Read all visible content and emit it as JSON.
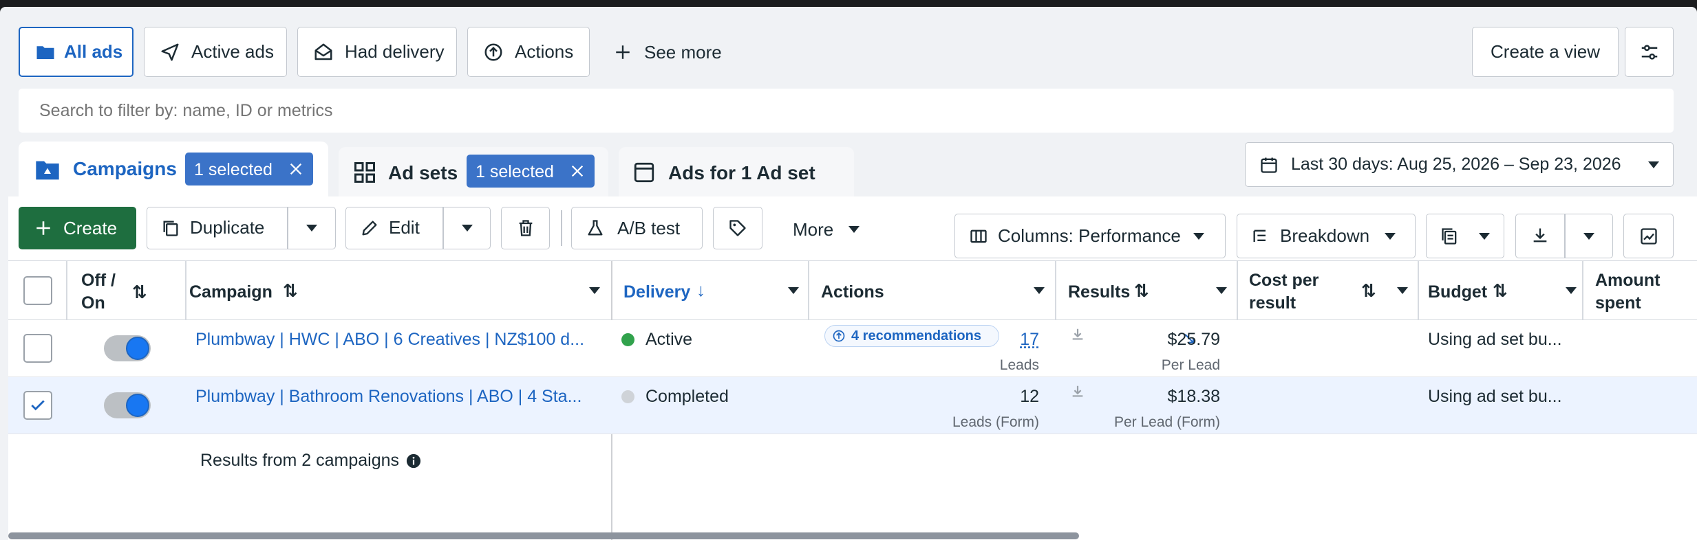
{
  "filters": {
    "all_ads": "All ads",
    "active_ads": "Active ads",
    "had_delivery": "Had delivery",
    "actions": "Actions",
    "see_more": "See more",
    "create_view": "Create a view"
  },
  "search": {
    "placeholder": "Search to filter by: name, ID or metrics"
  },
  "tabs": {
    "campaigns": {
      "label": "Campaigns",
      "badge": "1 selected"
    },
    "ad_sets": {
      "label": "Ad sets",
      "badge": "1 selected"
    },
    "ads": {
      "label": "Ads for 1 Ad set"
    }
  },
  "date_range": "Last 30 days: Aug 25, 2026 – Sep 23, 2026",
  "toolbar": {
    "create": "Create",
    "duplicate": "Duplicate",
    "edit": "Edit",
    "ab_test": "A/B test",
    "more": "More",
    "columns": "Columns: Performance",
    "breakdown": "Breakdown"
  },
  "table": {
    "headers": {
      "off_on_1": "Off /",
      "off_on_2": "On",
      "campaign": "Campaign",
      "delivery": "Delivery",
      "actions": "Actions",
      "results": "Results",
      "cost_1": "Cost per",
      "cost_2": "result",
      "budget": "Budget",
      "amount_1": "Amount",
      "amount_2": "spent"
    },
    "rows": [
      {
        "campaign": "Plumbway | HWC | ABO | 6 Creatives | NZ$100 d...",
        "delivery": "Active",
        "delivery_color": "#31a24c",
        "actions": "4 recommendations",
        "results": "17",
        "results_sub": "Leads",
        "cost": "$25.79",
        "cost_sub": "Per Lead",
        "budget": "Using ad set bu...",
        "selected": false,
        "on": true
      },
      {
        "campaign": "Plumbway | Bathroom Renovations | ABO | 4 Sta...",
        "delivery": "Completed",
        "delivery_color": "#cfd3d8",
        "actions": "",
        "results": "12",
        "results_sub": "Leads (Form)",
        "cost": "$18.38",
        "cost_sub": "Per Lead (Form)",
        "budget": "Using ad set bu...",
        "selected": true,
        "on": true
      }
    ],
    "footer": "Results from 2 campaigns"
  },
  "colors": {
    "accent": "#1d65c1",
    "create_green": "#1e6e3f",
    "badge_blue": "#3b73c8"
  }
}
